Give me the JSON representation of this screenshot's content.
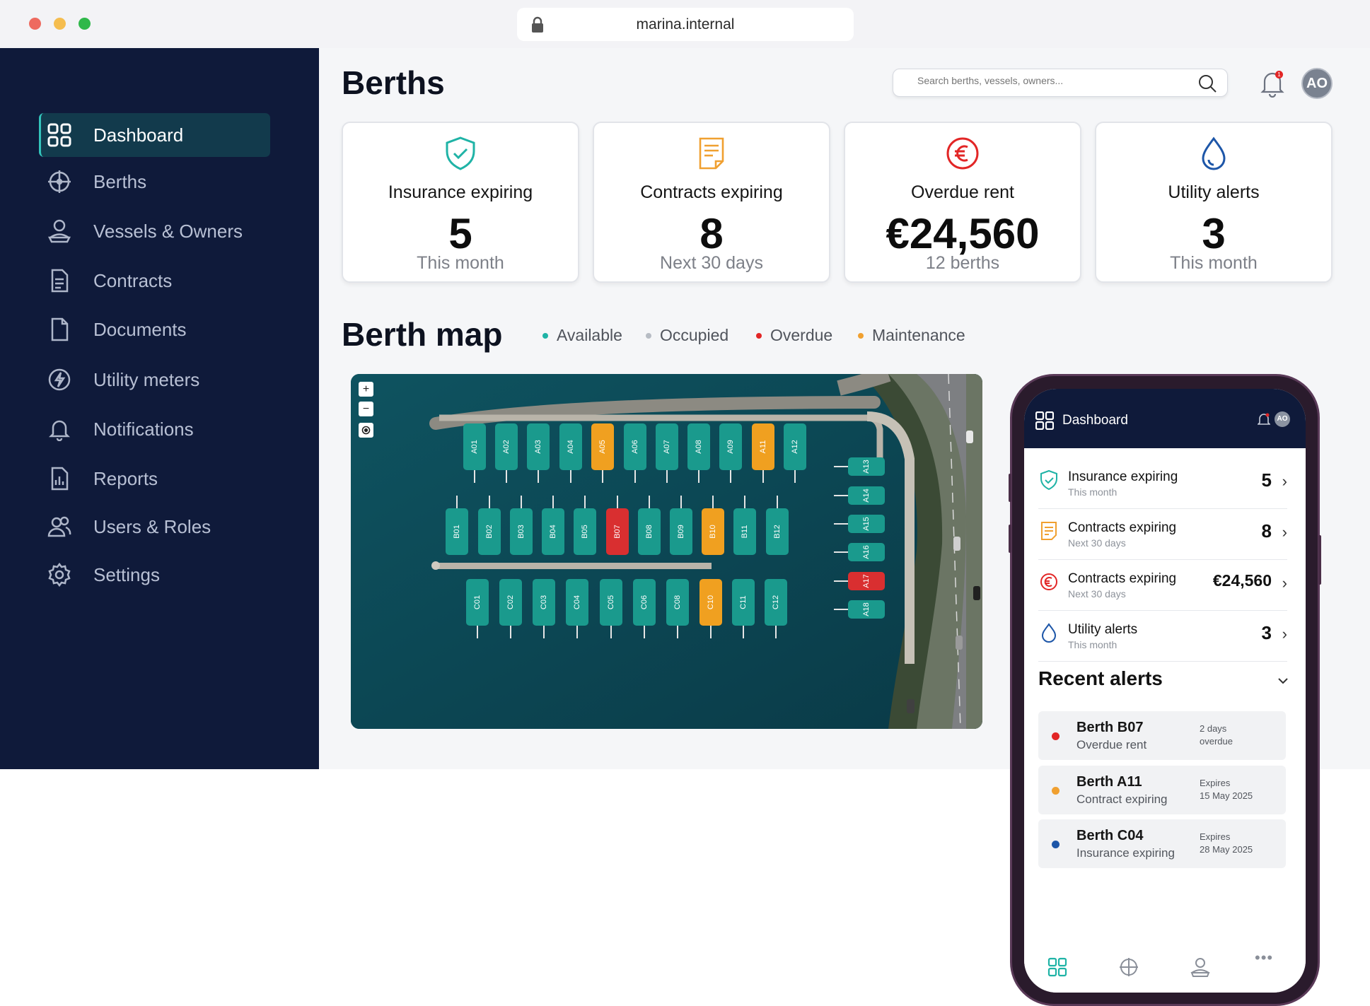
{
  "browser": {
    "url": "marina.internal"
  },
  "sidebar": {
    "items": [
      {
        "label": "Dashboard",
        "icon": "grid-icon",
        "active": true
      },
      {
        "label": "Berths",
        "icon": "crosshair-icon"
      },
      {
        "label": "Vessels & Owners",
        "icon": "captain-icon"
      },
      {
        "label": "Contracts",
        "icon": "document-icon"
      },
      {
        "label": "Documents",
        "icon": "file-icon"
      },
      {
        "label": "Utility meters",
        "icon": "bolt-icon"
      },
      {
        "label": "Notifications",
        "icon": "bell-icon"
      },
      {
        "label": "Reports",
        "icon": "chart-icon"
      },
      {
        "label": "Users & Roles",
        "icon": "users-icon"
      },
      {
        "label": "Settings",
        "icon": "gear-icon"
      }
    ]
  },
  "header": {
    "title": "Berths",
    "search_placeholder": "Search berths, vessels, owners...",
    "avatar_initials": "AO",
    "notification_count": "1"
  },
  "cards": [
    {
      "label": "Insurance expiring",
      "value": "5",
      "sub": "This month",
      "icon": "shield-check-icon",
      "color": "#1fb3a6"
    },
    {
      "label": "Contracts expiring",
      "value": "8",
      "sub": "Next 30 days",
      "icon": "contract-icon",
      "color": "#f0a030"
    },
    {
      "label": "Overdue rent",
      "value": "€24,560",
      "sub": "12 berths",
      "icon": "euro-icon",
      "color": "#e22626"
    },
    {
      "label": "Utility alerts",
      "value": "3",
      "sub": "This month",
      "icon": "water-drop-icon",
      "color": "#1d56a8"
    }
  ],
  "berth_map": {
    "title": "Berth map",
    "legend": [
      {
        "label": "Available",
        "color": "#1fb3a6"
      },
      {
        "label": "Occupied",
        "color": "#b7bcc4"
      },
      {
        "label": "Overdue",
        "color": "#e22626"
      },
      {
        "label": "Maintenance",
        "color": "#f0a030"
      }
    ],
    "controls": {
      "zoom_in": "+",
      "zoom_out": "−"
    },
    "berths_a_top": [
      {
        "id": "A01",
        "status": "available"
      },
      {
        "id": "A02",
        "status": "available"
      },
      {
        "id": "A03",
        "status": "available"
      },
      {
        "id": "A04",
        "status": "available"
      },
      {
        "id": "A05",
        "status": "maintenance"
      },
      {
        "id": "A06",
        "status": "available"
      },
      {
        "id": "A07",
        "status": "available"
      },
      {
        "id": "A08",
        "status": "available"
      },
      {
        "id": "A09",
        "status": "available"
      },
      {
        "id": "A11",
        "status": "maintenance"
      },
      {
        "id": "A12",
        "status": "available"
      }
    ],
    "berths_a_side": [
      {
        "id": "A13",
        "status": "available"
      },
      {
        "id": "A14",
        "status": "available"
      },
      {
        "id": "A15",
        "status": "available"
      },
      {
        "id": "A16",
        "status": "available"
      },
      {
        "id": "A17",
        "status": "overdue"
      },
      {
        "id": "A18",
        "status": "available"
      }
    ],
    "berths_b": [
      {
        "id": "B01",
        "status": "available"
      },
      {
        "id": "B02",
        "status": "available"
      },
      {
        "id": "B03",
        "status": "available"
      },
      {
        "id": "B04",
        "status": "available"
      },
      {
        "id": "B05",
        "status": "available"
      },
      {
        "id": "B07",
        "status": "overdue"
      },
      {
        "id": "B08",
        "status": "available"
      },
      {
        "id": "B09",
        "status": "available"
      },
      {
        "id": "B10",
        "status": "maintenance"
      },
      {
        "id": "B11",
        "status": "available"
      },
      {
        "id": "B12",
        "status": "available"
      }
    ],
    "berths_c": [
      {
        "id": "C01",
        "status": "available"
      },
      {
        "id": "C02",
        "status": "available"
      },
      {
        "id": "C03",
        "status": "available"
      },
      {
        "id": "C04",
        "status": "available"
      },
      {
        "id": "C05",
        "status": "available"
      },
      {
        "id": "C06",
        "status": "available"
      },
      {
        "id": "C08",
        "status": "available"
      },
      {
        "id": "C10",
        "status": "maintenance"
      },
      {
        "id": "C11",
        "status": "available"
      },
      {
        "id": "C12",
        "status": "available"
      }
    ]
  },
  "phone": {
    "header_title": "Dashboard",
    "avatar_initials": "AO",
    "rows": [
      {
        "label": "Insurance expiring",
        "sub": "This month",
        "value": "5",
        "icon": "shield-check-icon"
      },
      {
        "label": "Contracts expiring",
        "sub": "Next 30 days",
        "value": "8",
        "icon": "contract-icon"
      },
      {
        "label": "Contracts expiring",
        "sub": "Next 30 days",
        "value": "€24,560",
        "icon": "euro-icon"
      },
      {
        "label": "Utility alerts",
        "sub": "This month",
        "value": "3",
        "icon": "water-drop-icon"
      }
    ],
    "recent_alerts_title": "Recent alerts",
    "alerts": [
      {
        "title": "Berth B07",
        "sub": "Overdue rent",
        "meta1": "2 days",
        "meta2": "overdue",
        "color": "#e22626"
      },
      {
        "title": "Berth A11",
        "sub": "Contract expiring",
        "meta1": "Expires",
        "meta2": "15 May 2025",
        "color": "#f0a030"
      },
      {
        "title": "Berth C04",
        "sub": "Insurance expiring",
        "meta1": "Expires",
        "meta2": "28 May 2025",
        "color": "#1d56a8"
      }
    ],
    "tabbar": [
      "grid-icon",
      "crosshair-icon",
      "captain-icon",
      "more-icon"
    ]
  }
}
